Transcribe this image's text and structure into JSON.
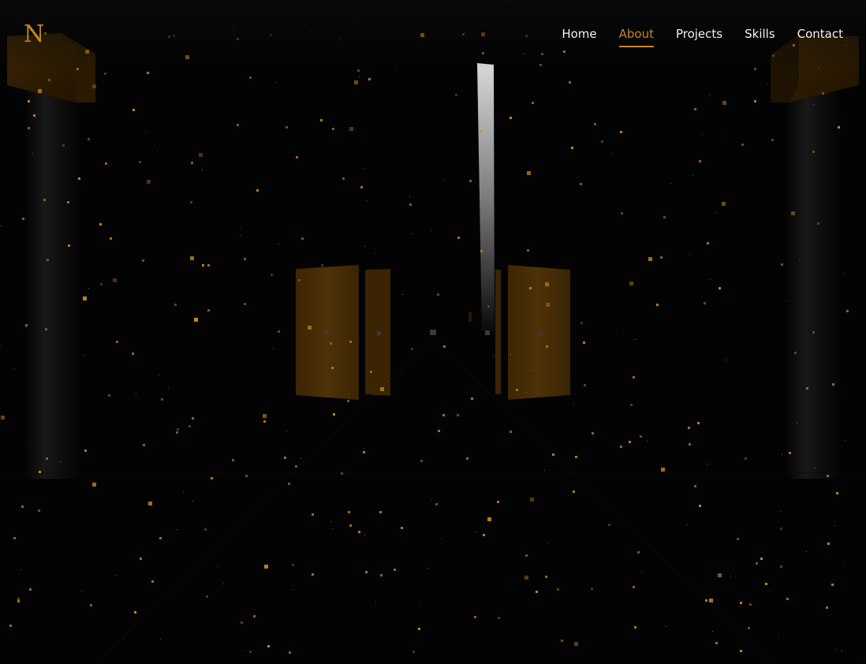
{
  "brand": {
    "logo_text": "N"
  },
  "nav": {
    "items": [
      {
        "label": "Home",
        "active": false
      },
      {
        "label": "About",
        "active": true
      },
      {
        "label": "Projects",
        "active": false
      },
      {
        "label": "Skills",
        "active": false
      },
      {
        "label": "Contact",
        "active": false
      }
    ]
  },
  "colors": {
    "background": "#030303",
    "accent_gold": "#c8871c",
    "panel_gold": "#5a3a08",
    "nav_text": "#f2f2f2"
  }
}
